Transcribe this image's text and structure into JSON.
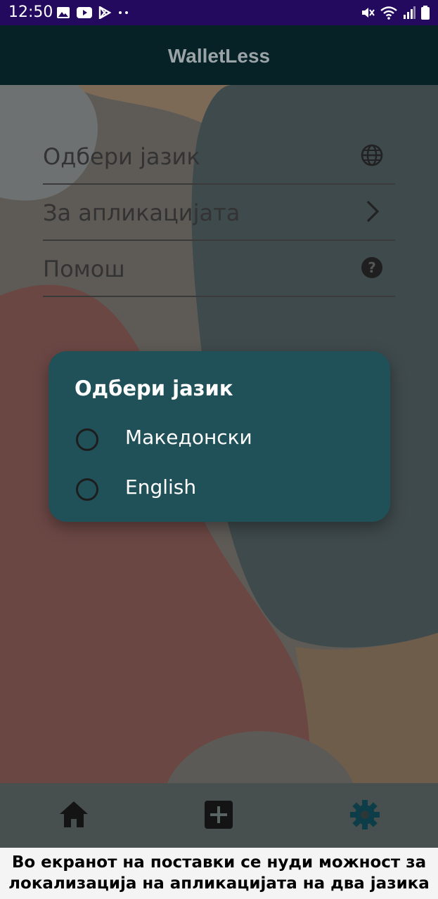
{
  "status_bar": {
    "time": "12:50",
    "left_icons": [
      "image-icon",
      "youtube-icon",
      "play-store-icon",
      "more-dots-icon"
    ],
    "right_icons": [
      "mute-icon",
      "wifi-icon",
      "signal-icon",
      "battery-icon"
    ]
  },
  "app_bar": {
    "title": "WalletLess"
  },
  "settings": {
    "items": [
      {
        "label": "Одбери јазик",
        "icon": "globe-icon"
      },
      {
        "label": "За апликацијата",
        "icon": "chevron-right-icon"
      },
      {
        "label": "Помош",
        "icon": "help-circle-icon"
      }
    ]
  },
  "dialog": {
    "title": "Одбери јазик",
    "options": [
      {
        "label": "Македонски",
        "selected": false
      },
      {
        "label": "English",
        "selected": false
      }
    ]
  },
  "bottom_nav": {
    "items": [
      {
        "icon": "home-icon",
        "active": false
      },
      {
        "icon": "add-box-icon",
        "active": false
      },
      {
        "icon": "settings-gear-icon",
        "active": true
      }
    ]
  },
  "caption": {
    "line1": "Во екранот на поставки се нуди можност за",
    "line2": "локализација на апликацијата на два јазика"
  },
  "colors": {
    "status_bar": "#230a5e",
    "app_bar": "#062227",
    "dialog": "#215158",
    "active_nav": "#0d3d48"
  }
}
